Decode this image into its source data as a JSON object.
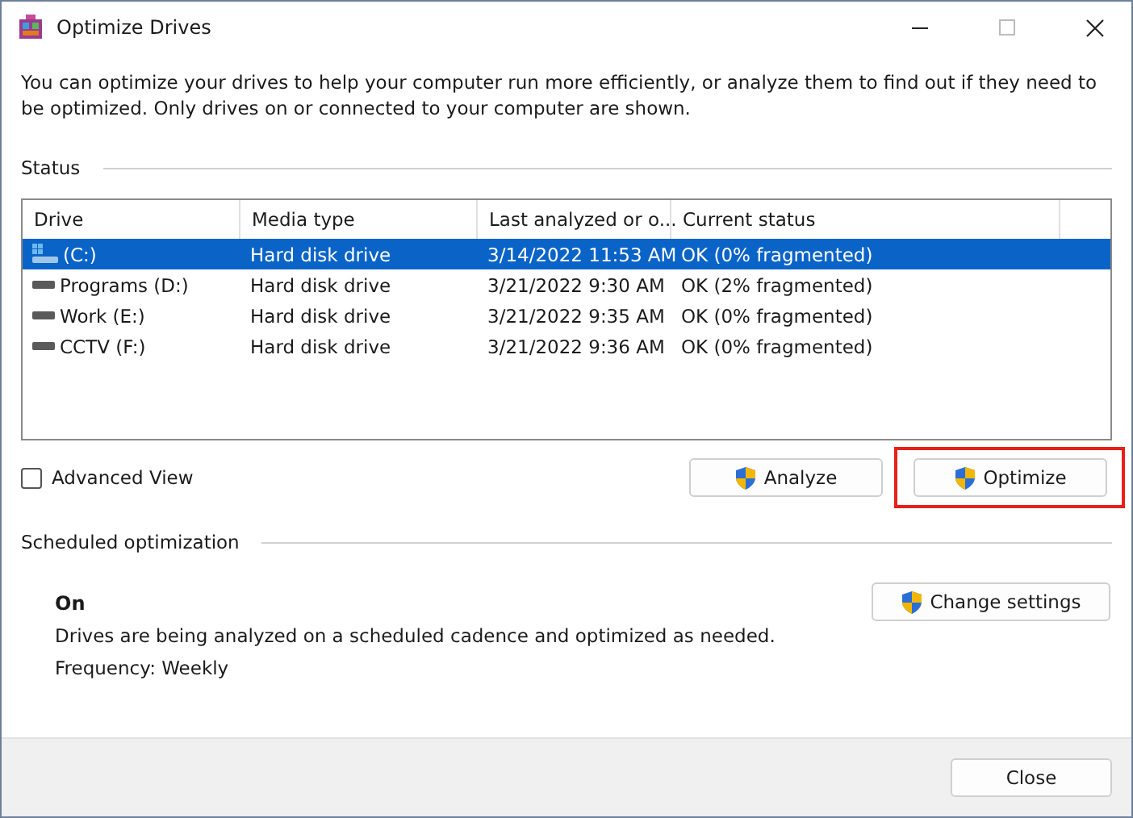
{
  "window": {
    "title": "Optimize Drives"
  },
  "intro": "You can optimize your drives to help your computer run more efficiently, or analyze them to find out if they need to be optimized. Only drives on or connected to your computer are shown.",
  "status": {
    "heading": "Status",
    "columns": [
      "Drive",
      "Media type",
      "Last analyzed or o...",
      "Current status"
    ],
    "rows": [
      {
        "kind": "system",
        "drive": "(C:)",
        "media_type": "Hard disk drive",
        "last_analyzed": "3/14/2022 11:53 AM",
        "current_status": "OK (0% fragmented)",
        "selected": true
      },
      {
        "kind": "data",
        "drive": "Programs (D:)",
        "media_type": "Hard disk drive",
        "last_analyzed": "3/21/2022 9:30 AM",
        "current_status": "OK (2% fragmented)",
        "selected": false
      },
      {
        "kind": "data",
        "drive": "Work (E:)",
        "media_type": "Hard disk drive",
        "last_analyzed": "3/21/2022 9:35 AM",
        "current_status": "OK (0% fragmented)",
        "selected": false
      },
      {
        "kind": "data",
        "drive": "CCTV (F:)",
        "media_type": "Hard disk drive",
        "last_analyzed": "3/21/2022 9:36 AM",
        "current_status": "OK (0% fragmented)",
        "selected": false
      }
    ],
    "advanced_view": {
      "label": "Advanced View",
      "checked": false
    },
    "buttons": [
      {
        "label": "Analyze",
        "highlighted": false
      },
      {
        "label": "Optimize",
        "highlighted": true
      }
    ]
  },
  "scheduled": {
    "heading": "Scheduled optimization",
    "state": "On",
    "description": "Drives are being analyzed on a scheduled cadence and optimized as needed.",
    "frequency": "Frequency: Weekly",
    "button": "Change settings"
  },
  "footer": {
    "button": "Close"
  }
}
